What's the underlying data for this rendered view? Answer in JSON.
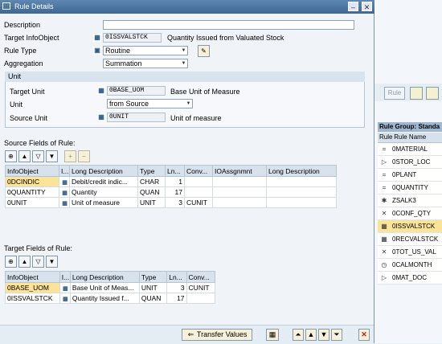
{
  "dialog": {
    "title": "Rule Details"
  },
  "form": {
    "description_label": "Description",
    "description_value": "",
    "target_infoobject_label": "Target InfoObject",
    "target_infoobject_value": "0ISSVALSTCK",
    "target_infoobject_desc": "Quantity Issued from Valuated Stock",
    "rule_type_label": "Rule Type",
    "rule_type_value": "Routine",
    "aggregation_label": "Aggregation",
    "aggregation_value": "Summation"
  },
  "unit_group": {
    "title": "Unit",
    "target_unit_label": "Target Unit",
    "target_unit_value": "0BASE_UOM",
    "target_unit_desc": "Base Unit of Measure",
    "unit_label": "Unit",
    "unit_value": "from Source",
    "source_unit_label": "Source Unit",
    "source_unit_value": "0UNIT",
    "source_unit_desc": "Unit of measure"
  },
  "source_fields": {
    "title": "Source Fields of Rule:",
    "headers": [
      "InfoObject",
      "I...",
      "Long Description",
      "Type",
      "Ln...",
      "Conv...",
      "IOAssgnmnt",
      "Long Description"
    ],
    "rows": [
      {
        "infoobject": "0DCINDIC",
        "long_desc": "Debit/credit indic...",
        "type": "CHAR",
        "len": "1",
        "conv": "",
        "ioassign": "",
        "long_desc2": ""
      },
      {
        "infoobject": "0QUANTITY",
        "long_desc": "Quantity",
        "type": "QUAN",
        "len": "17",
        "conv": "",
        "ioassign": "",
        "long_desc2": ""
      },
      {
        "infoobject": "0UNIT",
        "long_desc": "Unit of measure",
        "type": "UNIT",
        "len": "3",
        "conv": "CUNIT",
        "ioassign": "",
        "long_desc2": ""
      }
    ]
  },
  "target_fields": {
    "title": "Target Fields of Rule:",
    "headers": [
      "InfoObject",
      "I...",
      "Long Description",
      "Type",
      "Ln...",
      "Conv..."
    ],
    "rows": [
      {
        "infoobject": "0BASE_UOM",
        "long_desc": "Base Unit of Meas...",
        "type": "UNIT",
        "len": "3",
        "conv": "CUNIT"
      },
      {
        "infoobject": "0ISSVALSTCK",
        "long_desc": "Quantity Issued f...",
        "type": "QUAN",
        "len": "17",
        "conv": ""
      }
    ]
  },
  "footer": {
    "transfer_label": "Transfer Values"
  },
  "background": {
    "rule_button": "Rule",
    "group_header": "Rule Group: Standa",
    "col_rule": "Rule",
    "col_rule_name": "Rule Name",
    "rows": [
      {
        "icon": "=",
        "name": "0MATERIAL"
      },
      {
        "icon": "▷",
        "name": "0STOR_LOC"
      },
      {
        "icon": "=",
        "name": "0PLANT"
      },
      {
        "icon": "=",
        "name": "0QUANTITY"
      },
      {
        "icon": "✱",
        "name": "ZSALK3"
      },
      {
        "icon": "✕",
        "name": "0CONF_QTY"
      },
      {
        "icon": "▦",
        "name": "0ISSVALSTCK"
      },
      {
        "icon": "▦",
        "name": "0RECVALSTCK"
      },
      {
        "icon": "✕",
        "name": "0TOT_US_VAL"
      },
      {
        "icon": "◷",
        "name": "0CALMONTH"
      },
      {
        "icon": "▷",
        "name": "0MAT_DOC"
      }
    ]
  }
}
